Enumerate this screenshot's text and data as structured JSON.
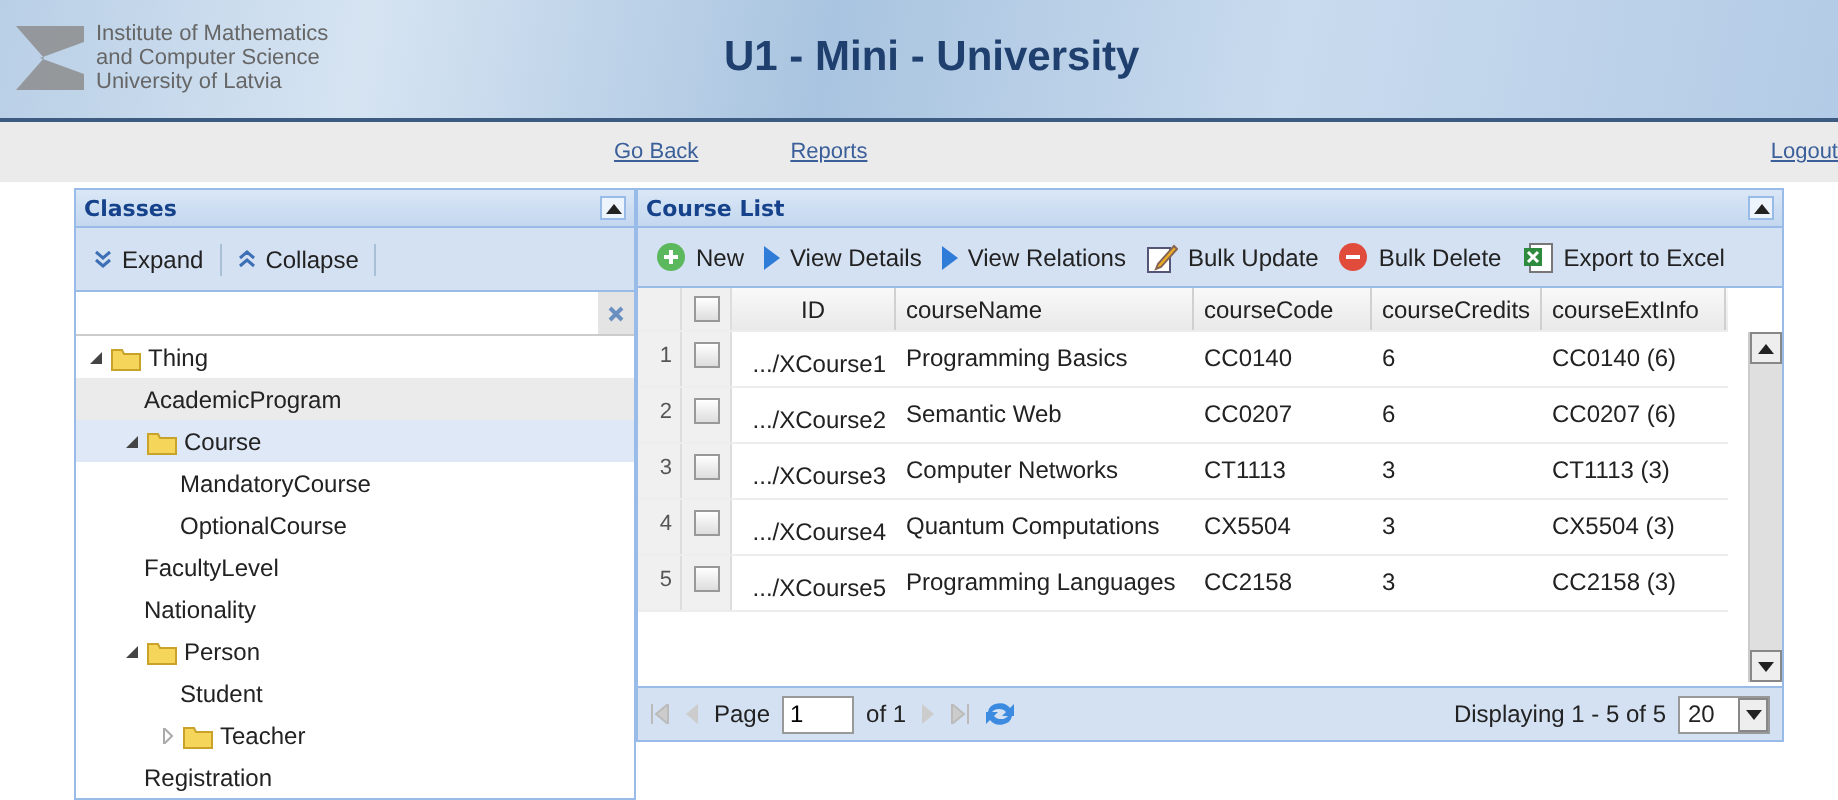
{
  "header": {
    "institute_lines": [
      "Institute of Mathematics",
      "and Computer Science",
      "University of Latvia"
    ],
    "title": "U1 - Mini - University"
  },
  "nav": {
    "links": [
      "Go Back",
      "Reports"
    ],
    "logout": "Logout"
  },
  "classes_panel": {
    "title": "Classes",
    "toolbar": [
      {
        "label": "Expand",
        "kind": "expand"
      },
      {
        "label": "Collapse",
        "kind": "collapse"
      }
    ],
    "tree": [
      {
        "label": "Thing",
        "kind": "folder",
        "expanded": true,
        "selected": false,
        "hovered": false,
        "children": [
          {
            "label": "AcademicProgram",
            "kind": "leaf",
            "selected": false,
            "hovered": true
          },
          {
            "label": "Course",
            "kind": "folder",
            "expanded": true,
            "selected": true,
            "hovered": false,
            "children": [
              {
                "label": "MandatoryCourse",
                "kind": "leaf",
                "selected": false,
                "hovered": false
              },
              {
                "label": "OptionalCourse",
                "kind": "leaf",
                "selected": false,
                "hovered": false
              }
            ]
          },
          {
            "label": "FacultyLevel",
            "kind": "leaf",
            "selected": false,
            "hovered": false
          },
          {
            "label": "Nationality",
            "kind": "leaf",
            "selected": false,
            "hovered": false
          },
          {
            "label": "Person",
            "kind": "folder",
            "expanded": true,
            "selected": false,
            "hovered": false,
            "children": [
              {
                "label": "Student",
                "kind": "leaf",
                "selected": false,
                "hovered": false
              },
              {
                "label": "Teacher",
                "kind": "folder",
                "expanded": false,
                "selected": false,
                "hovered": false
              }
            ]
          },
          {
            "label": "Registration",
            "kind": "leaf",
            "selected": false,
            "hovered": false
          }
        ]
      }
    ]
  },
  "course_panel": {
    "title": "Course List",
    "toolbar": [
      {
        "label": "New",
        "kind": "add"
      },
      {
        "label": "View Details",
        "kind": "arrow"
      },
      {
        "label": "View Relations",
        "kind": "arrow"
      },
      {
        "label": "Bulk Update",
        "kind": "edit"
      },
      {
        "label": "Bulk Delete",
        "kind": "delete"
      },
      {
        "label": "Export to Excel",
        "kind": "excel"
      }
    ],
    "select_all": {
      "checked": false
    },
    "columns": [
      "ID",
      "courseName",
      "courseCode",
      "courseCredits",
      "courseExtInfo"
    ],
    "rows": [
      {
        "number": "1",
        "checked": false,
        "cells": [
          ".../XCourse1",
          "Programming Basics",
          "CC0140",
          "6",
          "CC0140 (6)"
        ]
      },
      {
        "number": "2",
        "checked": false,
        "cells": [
          ".../XCourse2",
          "Semantic Web",
          "CC0207",
          "6",
          "CC0207 (6)"
        ]
      },
      {
        "number": "3",
        "checked": false,
        "cells": [
          ".../XCourse3",
          "Computer Networks",
          "CT1113",
          "3",
          "CT1113 (3)"
        ]
      },
      {
        "number": "4",
        "checked": false,
        "cells": [
          ".../XCourse4",
          "Quantum Computations",
          "CX5504",
          "3",
          "CX5504 (3)"
        ]
      },
      {
        "number": "5",
        "checked": false,
        "cells": [
          ".../XCourse5",
          "Programming Languages",
          "CC2158",
          "3",
          "CC2158 (3)"
        ]
      }
    ],
    "pager": {
      "page_label": "Page",
      "page": "1",
      "of": "of 1",
      "display": "Displaying 1 - 5 of 5",
      "page_size": "20"
    }
  }
}
